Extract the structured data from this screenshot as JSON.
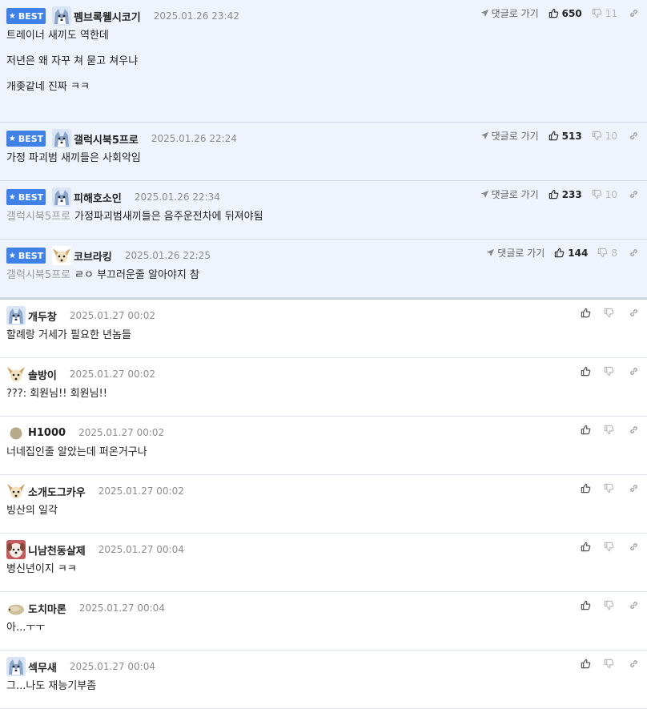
{
  "best_label": "BEST",
  "goto_label": "댓글로 가기",
  "best_comments": [
    {
      "nick": "펨브록웰시코기",
      "date": "2025.01.26 23:42",
      "likes": "650",
      "dislikes": "11",
      "reply_to": "",
      "text": "트레이너 새끼도 역한데\n\n저년은 왜 자꾸 쳐 묻고 쳐우냐\n\n개좆같네 진짜 ㅋㅋ",
      "avatar": "husky"
    },
    {
      "nick": "갤럭시북5프로",
      "date": "2025.01.26 22:24",
      "likes": "513",
      "dislikes": "10",
      "reply_to": "",
      "text": "가정 파괴범 새끼들은 사회악임",
      "avatar": "husky"
    },
    {
      "nick": "피해호소인",
      "date": "2025.01.26 22:34",
      "likes": "233",
      "dislikes": "10",
      "reply_to": "갤럭시북5프로",
      "text": "가정파괴범새끼들은 음주운전차에 뒤져야됨",
      "avatar": "husky"
    },
    {
      "nick": "코브라킹",
      "date": "2025.01.26 22:25",
      "likes": "144",
      "dislikes": "8",
      "reply_to": "갤럭시북5프로",
      "text": "ㄹㅇ 부끄러운줄 알아야지 참",
      "avatar": "chihuahua"
    }
  ],
  "comments": [
    {
      "nick": "개두창",
      "date": "2025.01.27 00:02",
      "text": "할례랑 거세가 필요한 년놈들",
      "avatar": "husky"
    },
    {
      "nick": "솔방이",
      "date": "2025.01.27 00:02",
      "text": "???: 회원님!! 회원님!!",
      "avatar": "chihuahua"
    },
    {
      "nick": "H1000",
      "date": "2025.01.27 00:02",
      "text": "너네집인줄 알았는데 퍼온거구나",
      "avatar": "circle"
    },
    {
      "nick": "소개도그카우",
      "date": "2025.01.27 00:02",
      "text": "빙산의 일각",
      "avatar": "chihuahua"
    },
    {
      "nick": "니남천동살제",
      "date": "2025.01.27 00:04",
      "text": "병신년이지 ㅋㅋ",
      "avatar": "dog2"
    },
    {
      "nick": "도치마론",
      "date": "2025.01.27 00:04",
      "text": "아...ㅜㅜ",
      "avatar": "hedgehog"
    },
    {
      "nick": "섹무새",
      "date": "2025.01.27 00:04",
      "text": "그...나도 재능기부좀",
      "avatar": "husky"
    }
  ],
  "icons": {
    "goto": "arrow-icon",
    "like": "thumbs-up-icon",
    "dislike": "thumbs-down-icon",
    "link": "link-icon"
  },
  "colors": {
    "best_badge": "#3f81e6",
    "best_bg": "#eff3fb",
    "date": "#8c8c8c"
  }
}
